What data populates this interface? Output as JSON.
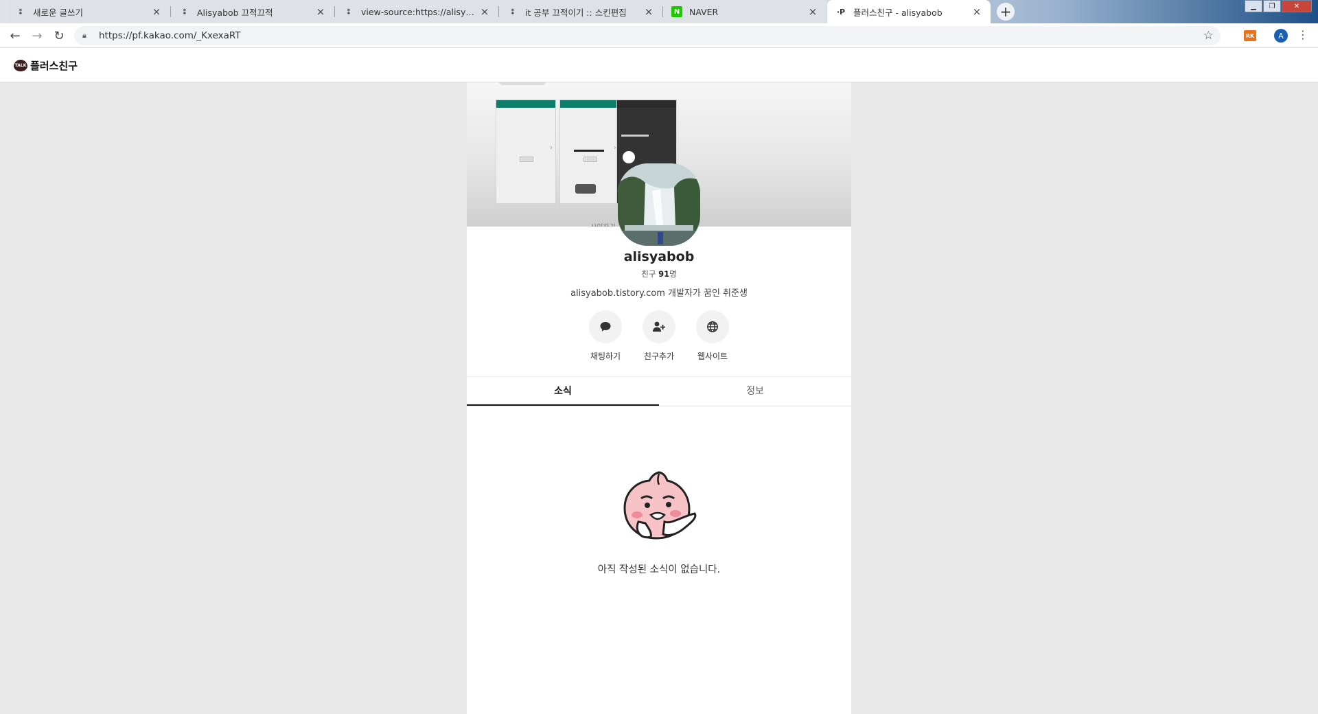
{
  "browser": {
    "tabs": [
      {
        "title": "새로운 글쓰기",
        "favicon": "tistory-icon"
      },
      {
        "title": "Alisyabob 끄적끄적",
        "favicon": "tistory-icon"
      },
      {
        "title": "view-source:https://alisyabob.tis",
        "favicon": "tistory-icon"
      },
      {
        "title": "it 공부 끄적이기 :: 스킨편집",
        "favicon": "tistory-icon"
      },
      {
        "title": "NAVER",
        "favicon": "naver-icon"
      },
      {
        "title": "플러스친구 - alisyabob",
        "favicon": "kakao-plus-icon"
      }
    ],
    "url": "https://pf.kakao.com/_KxexaRT",
    "profile_initial": "A",
    "extension_label": "RK"
  },
  "site": {
    "logo_badge": "TALK",
    "logo_text": "플러스친구"
  },
  "profile": {
    "name": "alisyabob",
    "friends_prefix": "친구 ",
    "friends_count": "91",
    "friends_suffix": "명",
    "description": "alisyabob.tistory.com 개발자가 꿈인 취준생",
    "cover_caption": "사인하기 ... 수 있어",
    "actions": [
      {
        "label": "채팅하기",
        "icon": "chat-bubble-icon"
      },
      {
        "label": "친구추가",
        "icon": "add-friend-icon"
      },
      {
        "label": "웹사이트",
        "icon": "globe-icon"
      }
    ],
    "tabs": [
      "소식",
      "정보"
    ],
    "active_tab": "소식",
    "empty_message": "아직 작성된 소식이 없습니다."
  }
}
